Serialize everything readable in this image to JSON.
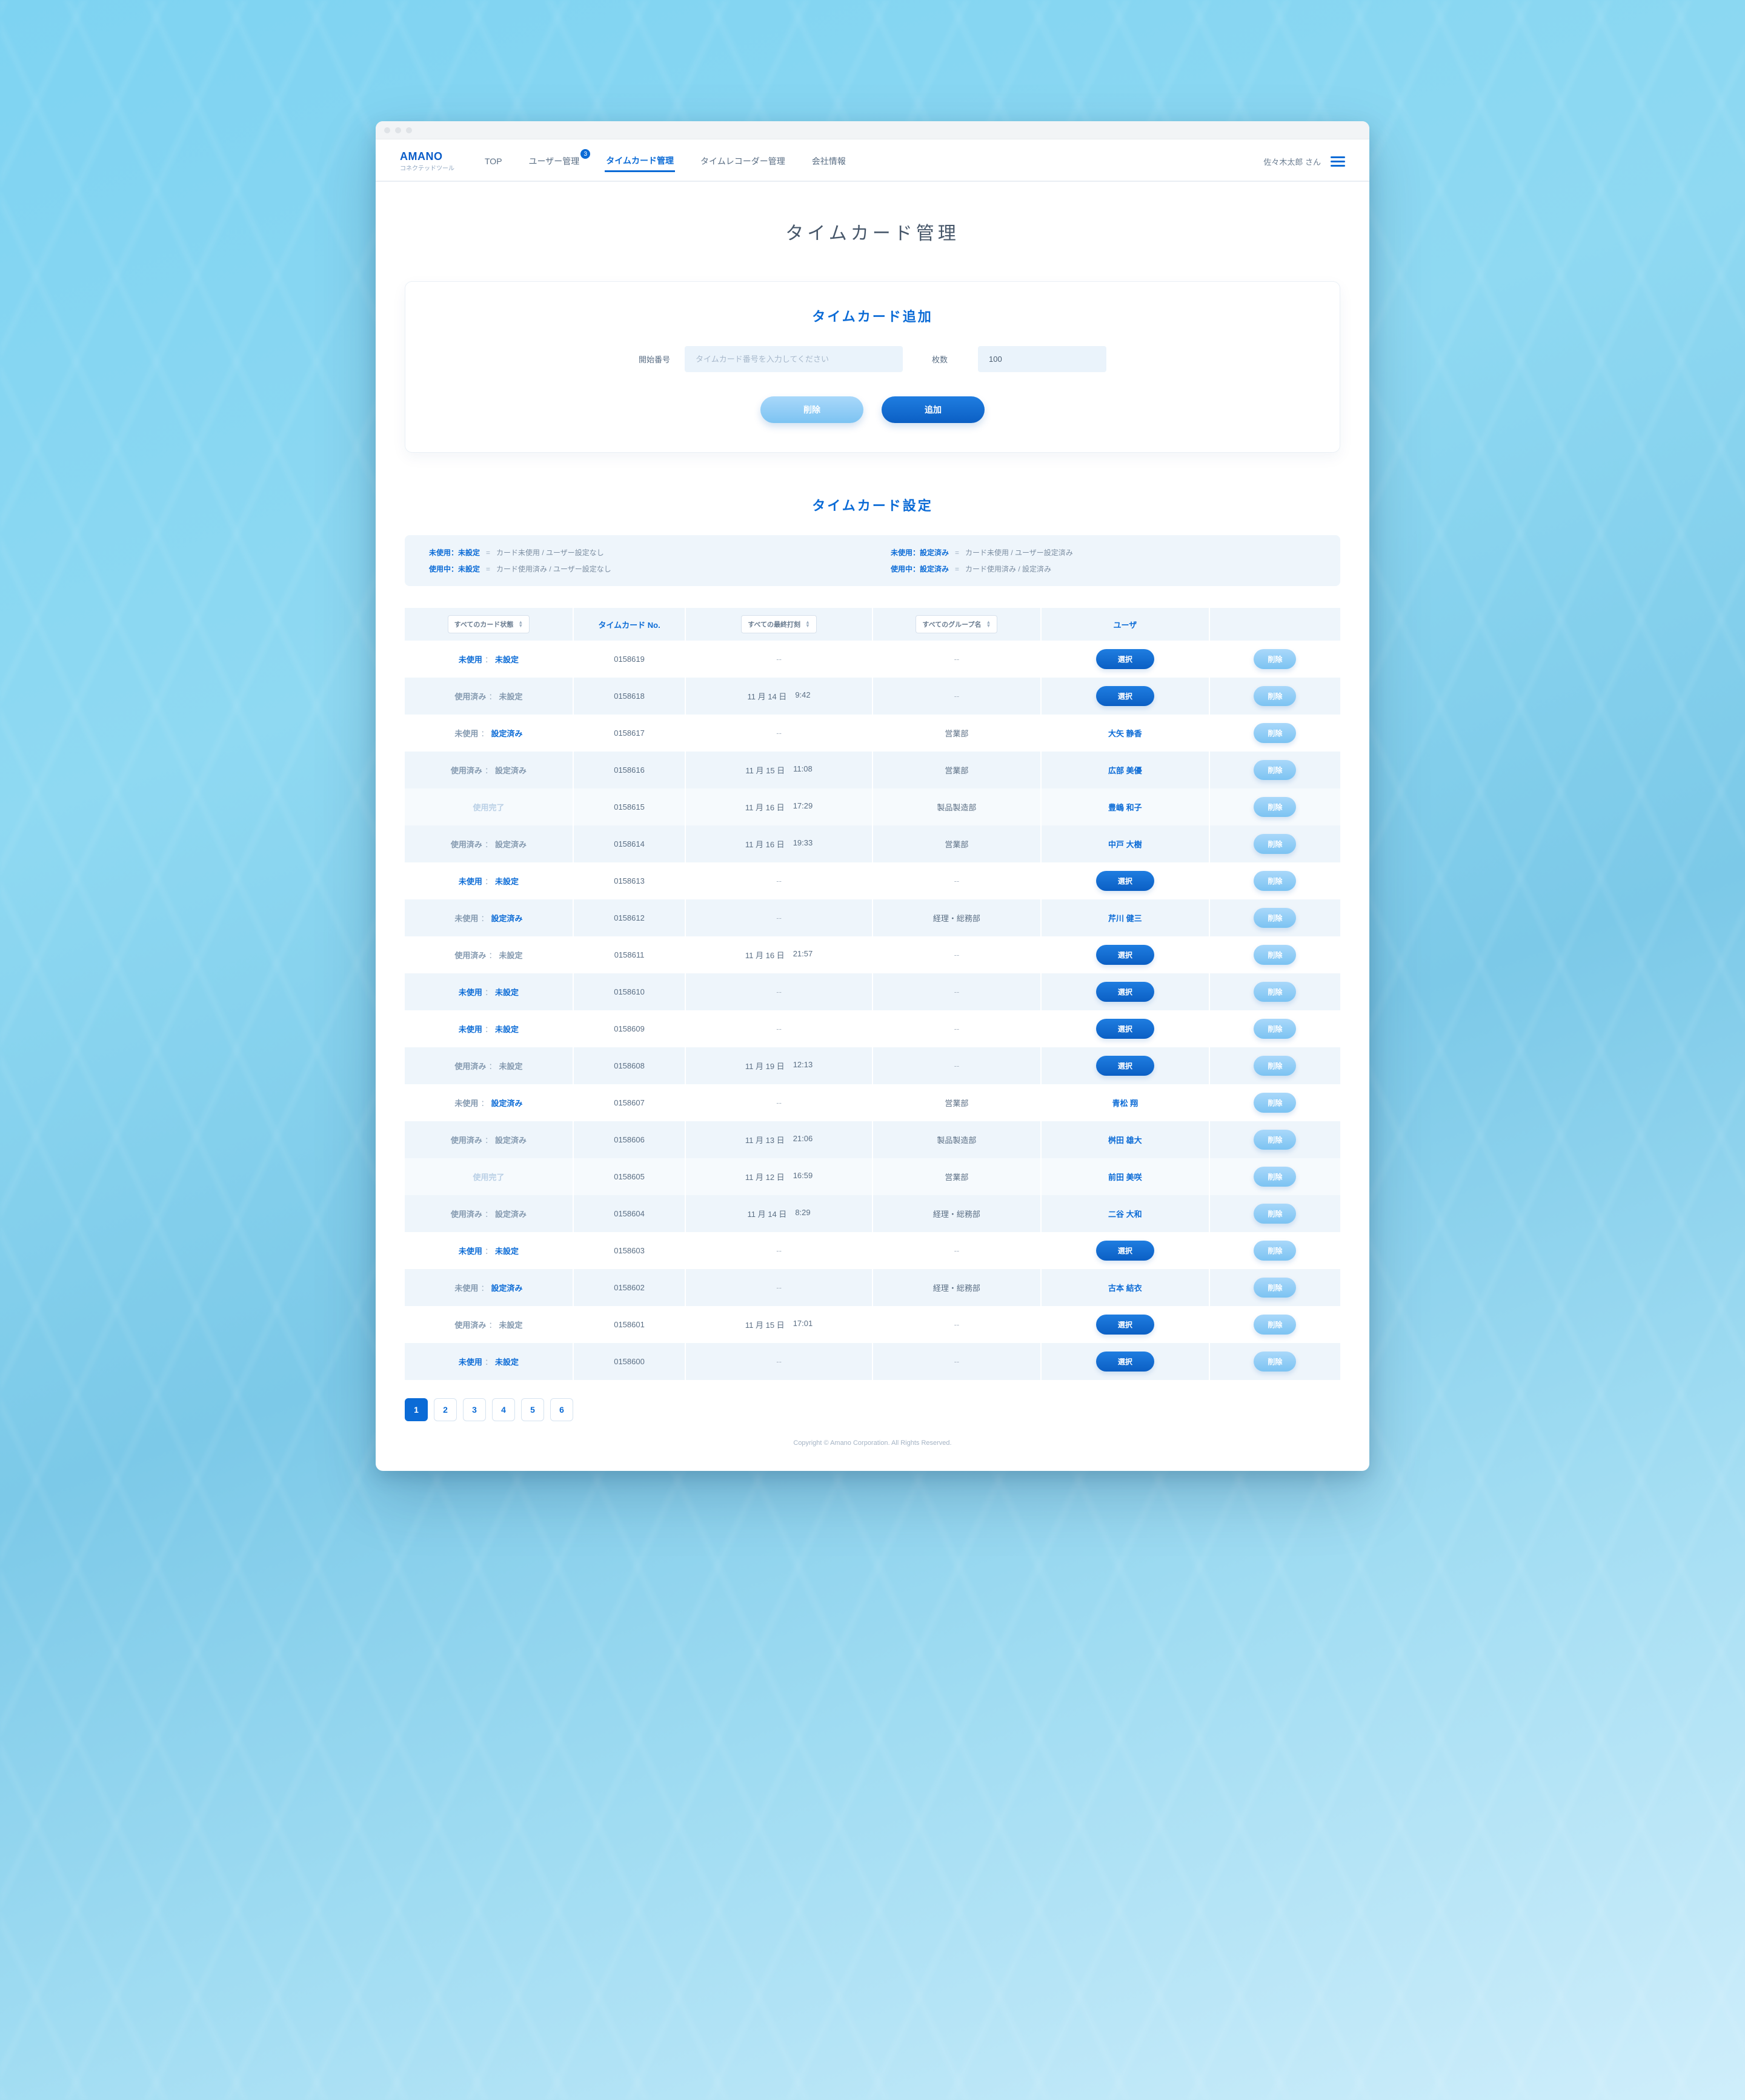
{
  "brand": {
    "title": "AMANO",
    "subtitle": "コネクテッドツール"
  },
  "nav": {
    "top": "TOP",
    "users": "ユーザー管理",
    "users_badge": "3",
    "timecard": "タイムカード管理",
    "recorder": "タイムレコーダー管理",
    "company": "会社情報"
  },
  "account_name": "佐々木太郎 さん",
  "page_title": "タイムカード管理",
  "add_panel": {
    "title": "タイムカード追加",
    "start_label": "開始番号",
    "start_placeholder": "タイムカード番号を入力してください",
    "count_label": "枚数",
    "count_value": "100",
    "delete_btn": "削除",
    "add_btn": "追加"
  },
  "settings_title": "タイムカード設定",
  "legend": [
    {
      "key": "未使用：未設定",
      "desc": "カード未使用 / ユーザー設定なし"
    },
    {
      "key": "未使用：設定済み",
      "desc": "カード未使用 / ユーザー設定済み"
    },
    {
      "key": "使用中：未設定",
      "desc": "カード使用済み / ユーザー設定なし"
    },
    {
      "key": "使用中：設定済み",
      "desc": "カード使用済み / 設定済み"
    }
  ],
  "table": {
    "headers": {
      "status_select": "すべてのカード状態",
      "no": "タイムカード No.",
      "stamp_select": "すべての最終打刻",
      "group_select": "すべてのグループ名",
      "user": "ユーザ",
      "select_btn": "選択",
      "delete_btn": "削除"
    },
    "rows": [
      {
        "s1": "未使用",
        "s2": "未設定",
        "style": "bold",
        "no": "0158619",
        "date": "--",
        "time": "--",
        "group": "--",
        "user": "",
        "action": "select"
      },
      {
        "s1": "使用済み",
        "s2": "未設定",
        "style": "muted",
        "no": "0158618",
        "date": "11 月 14 日",
        "time": "9:42",
        "group": "--",
        "user": "",
        "action": "select"
      },
      {
        "s1": "未使用",
        "s2": "設定済み",
        "style": "mix",
        "no": "0158617",
        "date": "--",
        "time": "--",
        "group": "営業部",
        "user": "大矢 静香",
        "action": "name"
      },
      {
        "s1": "使用済み",
        "s2": "設定済み",
        "style": "muted",
        "no": "0158616",
        "date": "11 月 15 日",
        "time": "11:08",
        "group": "営業部",
        "user": "広部 美優",
        "action": "name"
      },
      {
        "s1": "使用完了",
        "s2": "",
        "style": "done",
        "no": "0158615",
        "date": "11 月 16 日",
        "time": "17:29",
        "group": "製品製造部",
        "user": "豊嶋 和子",
        "action": "name"
      },
      {
        "s1": "使用済み",
        "s2": "設定済み",
        "style": "muted",
        "no": "0158614",
        "date": "11 月 16 日",
        "time": "19:33",
        "group": "営業部",
        "user": "中戸 大樹",
        "action": "name"
      },
      {
        "s1": "未使用",
        "s2": "未設定",
        "style": "bold",
        "no": "0158613",
        "date": "--",
        "time": "--",
        "group": "--",
        "user": "",
        "action": "select"
      },
      {
        "s1": "未使用",
        "s2": "設定済み",
        "style": "mix",
        "no": "0158612",
        "date": "--",
        "time": "--",
        "group": "経理・総務部",
        "user": "芹川 健三",
        "action": "name"
      },
      {
        "s1": "使用済み",
        "s2": "未設定",
        "style": "muted",
        "no": "0158611",
        "date": "11 月 16 日",
        "time": "21:57",
        "group": "--",
        "user": "",
        "action": "select"
      },
      {
        "s1": "未使用",
        "s2": "未設定",
        "style": "bold",
        "no": "0158610",
        "date": "--",
        "time": "--",
        "group": "--",
        "user": "",
        "action": "select"
      },
      {
        "s1": "未使用",
        "s2": "未設定",
        "style": "bold",
        "no": "0158609",
        "date": "--",
        "time": "--",
        "group": "--",
        "user": "",
        "action": "select"
      },
      {
        "s1": "使用済み",
        "s2": "未設定",
        "style": "muted",
        "no": "0158608",
        "date": "11 月 19 日",
        "time": "12:13",
        "group": "--",
        "user": "",
        "action": "select"
      },
      {
        "s1": "未使用",
        "s2": "設定済み",
        "style": "mix",
        "no": "0158607",
        "date": "--",
        "time": "--",
        "group": "営業部",
        "user": "青松 翔",
        "action": "name"
      },
      {
        "s1": "使用済み",
        "s2": "設定済み",
        "style": "muted",
        "no": "0158606",
        "date": "11 月 13 日",
        "time": "21:06",
        "group": "製品製造部",
        "user": "桝田 雄大",
        "action": "name"
      },
      {
        "s1": "使用完了",
        "s2": "",
        "style": "done",
        "no": "0158605",
        "date": "11 月 12 日",
        "time": "16:59",
        "group": "営業部",
        "user": "前田 美咲",
        "action": "name"
      },
      {
        "s1": "使用済み",
        "s2": "設定済み",
        "style": "muted",
        "no": "0158604",
        "date": "11 月 14 日",
        "time": "8:29",
        "group": "経理・総務部",
        "user": "二谷 大和",
        "action": "name"
      },
      {
        "s1": "未使用",
        "s2": "未設定",
        "style": "bold",
        "no": "0158603",
        "date": "--",
        "time": "--",
        "group": "--",
        "user": "",
        "action": "select"
      },
      {
        "s1": "未使用",
        "s2": "設定済み",
        "style": "mix",
        "no": "0158602",
        "date": "--",
        "time": "--",
        "group": "経理・総務部",
        "user": "古本 結衣",
        "action": "name"
      },
      {
        "s1": "使用済み",
        "s2": "未設定",
        "style": "muted",
        "no": "0158601",
        "date": "11 月 15 日",
        "time": "17:01",
        "group": "--",
        "user": "",
        "action": "select"
      },
      {
        "s1": "未使用",
        "s2": "未設定",
        "style": "bold",
        "no": "0158600",
        "date": "--",
        "time": "--",
        "group": "--",
        "user": "",
        "action": "select"
      }
    ]
  },
  "pagination": [
    "1",
    "2",
    "3",
    "4",
    "5",
    "6"
  ],
  "copyright": "Copyright © Amano Corporation. All Rights Reserved."
}
